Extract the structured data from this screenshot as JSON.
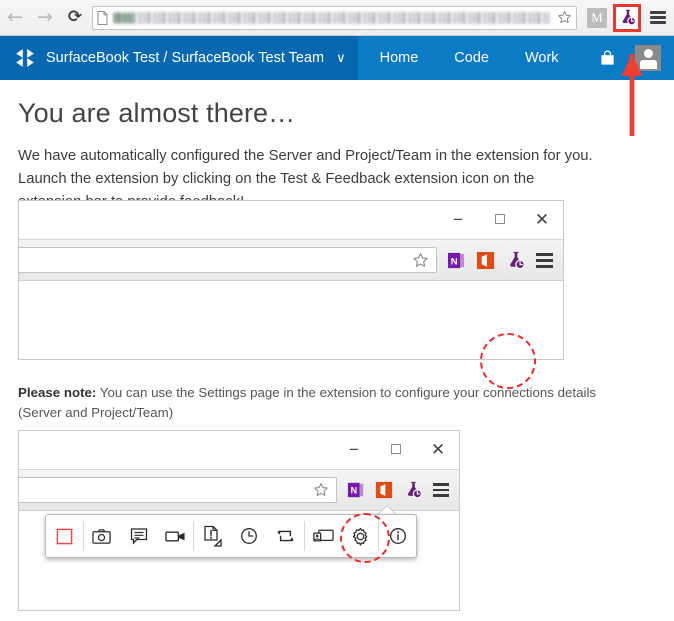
{
  "browser": {
    "back_icon": "arrow-left-icon",
    "forward_icon": "arrow-right-icon",
    "reload_icon": "reload-icon",
    "reload_glyph": "⟳",
    "back_glyph": "←",
    "forward_glyph": "→",
    "page_icon": "page-document-icon",
    "url_value": "",
    "url_placeholder": "",
    "bookmark_icon": "star-outline-icon",
    "m_badge_label": "M",
    "extension_icon": "test-and-feedback-flask-icon",
    "menu_icon": "hamburger-menu-icon",
    "extension_highlight_color": "#e8392e"
  },
  "vsts_header": {
    "logo_icon": "visual-studio-team-services-logo",
    "project_title": "SurfaceBook Test / SurfaceBook Test Team",
    "chevron_icon": "chevron-down-icon",
    "chevron_glyph": "∨",
    "nav": [
      {
        "label": "Home"
      },
      {
        "label": "Code"
      },
      {
        "label": "Work"
      }
    ],
    "marketplace_icon": "shopping-bag-icon",
    "avatar_icon": "user-avatar",
    "overflow_icon": "ellipsis-menu-icon",
    "overflow_glyph": "•••",
    "bar_color": "#0a7bc4",
    "bar_color_left": "#0668b1"
  },
  "main": {
    "title": "You are almost there…",
    "intro": "We have automatically configured the Server and Project/Team in the extension for you. Launch the extension by clicking on the Test & Feedback extension icon on the extension bar to provide feedback!",
    "note_label": "Please note:",
    "note_text": " You can use the Settings page in the extension to configure your connections details (Server and Project/Team)"
  },
  "illustration_one": {
    "name": "browser-window-illustration-extension-icon",
    "window_controls": {
      "minimize_icon": "minimize-icon",
      "minimize_glyph": "−",
      "maximize_icon": "maximize-icon",
      "maximize_glyph": "□",
      "close_icon": "close-icon",
      "close_glyph": "✕"
    },
    "address_bar_value": "",
    "bookmark_icon": "star-outline-icon",
    "toolbar_icons": [
      {
        "name": "onenote-icon",
        "label": "N",
        "color": "#7719aa"
      },
      {
        "name": "office-icon",
        "label": "",
        "color": "#e04b16"
      },
      {
        "name": "test-and-feedback-flask-icon",
        "label": "",
        "color": "#68217a",
        "highlighted": true
      },
      {
        "name": "hamburger-menu-icon",
        "label": "",
        "color": "#404040"
      }
    ],
    "highlight_color": "#ee2b2b"
  },
  "illustration_two": {
    "name": "browser-window-illustration-settings-gear",
    "window_controls": {
      "minimize_icon": "minimize-icon",
      "minimize_glyph": "−",
      "maximize_icon": "maximize-icon",
      "maximize_glyph": "□",
      "close_icon": "close-icon",
      "close_glyph": "✕"
    },
    "address_bar_value": "",
    "bookmark_icon": "star-outline-icon",
    "toolbar_icons": [
      {
        "name": "onenote-icon",
        "label": "N",
        "color": "#7719aa"
      },
      {
        "name": "office-icon",
        "label": "",
        "color": "#e04b16"
      },
      {
        "name": "test-and-feedback-flask-icon",
        "label": "",
        "color": "#68217a"
      },
      {
        "name": "hamburger-menu-icon",
        "label": "",
        "color": "#404040"
      }
    ],
    "popup_toolbar_icons": [
      {
        "name": "stop-capture-icon",
        "color": "#ef4b4b"
      },
      {
        "name": "screenshot-camera-icon",
        "color": "#2b2b2b"
      },
      {
        "name": "add-note-comment-icon",
        "color": "#2b2b2b"
      },
      {
        "name": "screen-recording-video-icon",
        "color": "#2b2b2b"
      },
      {
        "name": "create-bug-page-icon",
        "color": "#2b2b2b"
      },
      {
        "name": "recent-history-clock-icon",
        "color": "#2b2b2b"
      },
      {
        "name": "refresh-session-icon",
        "color": "#2b2b2b"
      },
      {
        "name": "screen-capture-region-icon",
        "color": "#2b2b2b"
      },
      {
        "name": "settings-gear-icon",
        "color": "#2b2b2b",
        "highlighted": true
      },
      {
        "name": "info-icon",
        "color": "#2b2b2b"
      }
    ],
    "highlight_color": "#ee2b2b"
  },
  "callout": {
    "name": "red-callout-arrow-to-extension-icon",
    "color": "#e8392e"
  }
}
